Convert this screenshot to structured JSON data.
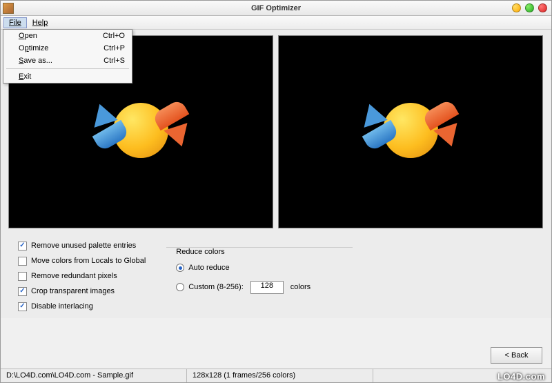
{
  "window": {
    "title": "GIF Optimizer"
  },
  "menubar": {
    "file": "File",
    "help": "Help"
  },
  "file_menu": {
    "open": {
      "label": "Open",
      "shortcut": "Ctrl+O"
    },
    "optimize": {
      "label": "Optimize",
      "shortcut": "Ctrl+P"
    },
    "saveas": {
      "label": "Save as...",
      "shortcut": "Ctrl+S"
    },
    "exit": {
      "label": "Exit"
    }
  },
  "options": {
    "remove_unused": {
      "label": "Remove unused palette entries",
      "checked": true
    },
    "move_colors": {
      "label": "Move colors from Locals to Global",
      "checked": false
    },
    "remove_redundant": {
      "label": "Remove redundant pixels",
      "checked": false
    },
    "crop_transparent": {
      "label": "Crop transparent images",
      "checked": true
    },
    "disable_interlacing": {
      "label": "Disable interlacing",
      "checked": true
    }
  },
  "reduce": {
    "legend": "Reduce colors",
    "auto": {
      "label": "Auto reduce",
      "selected": true
    },
    "custom": {
      "label": "Custom (8-256):",
      "selected": false,
      "value": "128",
      "suffix": "colors"
    }
  },
  "buttons": {
    "back": "< Back"
  },
  "status": {
    "path": "D:\\LO4D.com\\LO4D.com - Sample.gif",
    "info": "128x128 (1 frames/256 colors)"
  },
  "watermark": "LO4D.com"
}
